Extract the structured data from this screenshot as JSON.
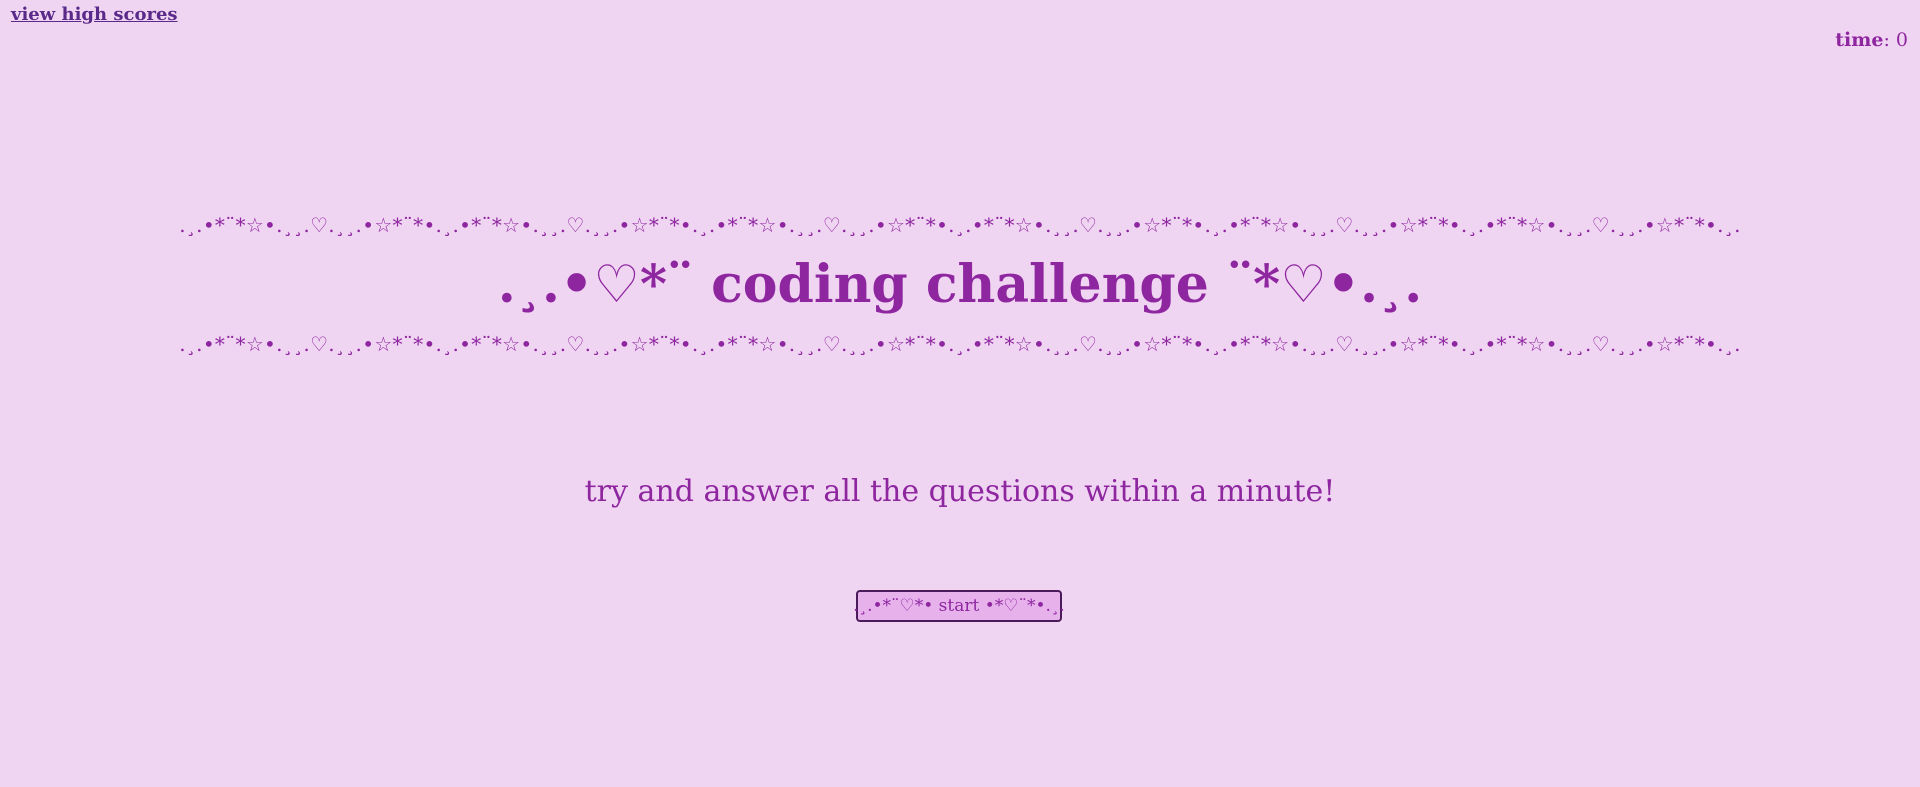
{
  "nav": {
    "high_scores_label": "view high scores"
  },
  "timer": {
    "label": "time",
    "separator": ": ",
    "value": "0"
  },
  "banner": {
    "decoration": ".¸.•*¨*☆•.¸¸.♡.¸¸.•☆*¨*•.¸.•*¨*☆•.¸¸.♡.¸¸.•☆*¨*•.¸.•*¨*☆•.¸¸.♡.¸¸.•☆*¨*•.¸.•*¨*☆•.¸¸.♡.¸¸.•☆*¨*•.¸.•*¨*☆•.¸¸.♡.¸¸.•☆*¨*•.¸.•*¨*☆•.¸¸.♡.¸¸.•☆*¨*•.¸.",
    "title": ".¸.•♡*¨ coding challenge ¨*♡•.¸."
  },
  "intro": {
    "subtitle": "try and answer all the questions within a minute!"
  },
  "actions": {
    "start_label": ".¸.•*¨♡*• start •*♡¨*•.¸."
  },
  "colors": {
    "background": "#f0d5f2",
    "accent": "#8e26a0",
    "link": "#5a2a8a",
    "button_bg": "#e7b2ec",
    "button_border": "#4a1a5a"
  }
}
